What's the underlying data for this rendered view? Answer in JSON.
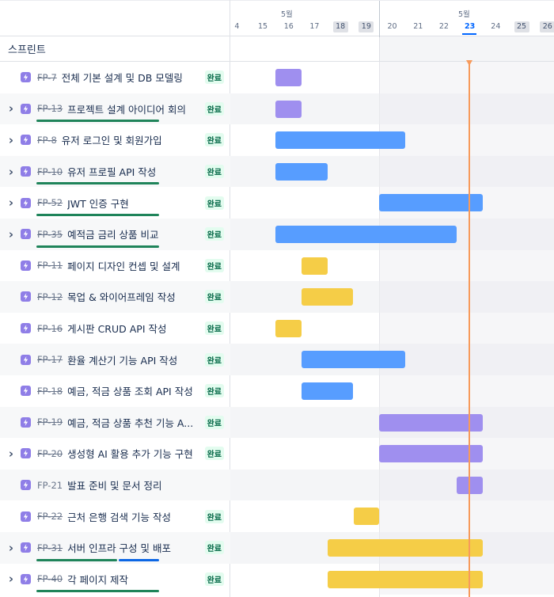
{
  "header": {
    "sprint_label": "스프린트"
  },
  "timeline": {
    "months": [
      {
        "label": "5월"
      },
      {
        "label": "5월"
      }
    ],
    "days": [
      "4",
      "15",
      "16",
      "17",
      "18",
      "19",
      "20",
      "21",
      "22",
      "23",
      "24",
      "25",
      "26"
    ],
    "weekend_days": [
      "18",
      "19",
      "25",
      "26"
    ],
    "today": "23"
  },
  "colors": {
    "purple": "#9f8fef",
    "blue": "#579dff",
    "yellow": "#f5cd47",
    "green": "#1f845a",
    "progress_blue": "#0c66e4",
    "today_line": "#f79a5b"
  },
  "status_label": "완료",
  "rows": [
    {
      "key": "FP-7",
      "title": "전체 기본 설계 및 DB 모델링",
      "expand": false,
      "done": true,
      "status": "완료",
      "progress": false,
      "bar_color": "purple",
      "start": "16",
      "end": "16"
    },
    {
      "key": "FP-13",
      "title": "프로젝트 설계 아이디어 회의",
      "expand": true,
      "done": true,
      "status": "",
      "progress": "green",
      "bar_color": "purple",
      "start": "16",
      "end": "16"
    },
    {
      "key": "FP-8",
      "title": "유저 로그인 및 회원가입",
      "expand": true,
      "done": true,
      "status": "완료",
      "progress": false,
      "bar_color": "blue",
      "start": "16",
      "end": "20"
    },
    {
      "key": "FP-10",
      "title": "유저 프로필 API 작성",
      "expand": true,
      "done": true,
      "status": "완료",
      "progress": "green",
      "bar_color": "blue",
      "start": "16",
      "end": "17"
    },
    {
      "key": "FP-52",
      "title": "JWT 인증 구현",
      "expand": true,
      "done": true,
      "status": "완료",
      "progress": "green",
      "bar_color": "blue",
      "start": "20",
      "end": "23"
    },
    {
      "key": "FP-35",
      "title": "예적금 금리 상품 비교",
      "expand": true,
      "done": true,
      "status": "완료",
      "progress": "green",
      "bar_color": "blue",
      "start": "16",
      "end": "22"
    },
    {
      "key": "FP-11",
      "title": "페이지 디자인 컨셉 및 설계",
      "expand": false,
      "done": true,
      "status": "완료",
      "progress": false,
      "bar_color": "yellow",
      "start": "17",
      "end": "17"
    },
    {
      "key": "FP-12",
      "title": "목업 & 와이어프레임 작성",
      "expand": false,
      "done": true,
      "status": "완료",
      "progress": false,
      "bar_color": "yellow",
      "start": "17",
      "end": "18"
    },
    {
      "key": "FP-16",
      "title": "게시판 CRUD API 작성",
      "expand": false,
      "done": true,
      "status": "완료",
      "progress": false,
      "bar_color": "yellow",
      "start": "16",
      "end": "16"
    },
    {
      "key": "FP-17",
      "title": "환율 계산기 기능 API 작성",
      "expand": false,
      "done": true,
      "status": "완료",
      "progress": false,
      "bar_color": "blue",
      "start": "17",
      "end": "20"
    },
    {
      "key": "FP-18",
      "title": "예금, 적금 상품 조회 API 작성",
      "expand": false,
      "done": true,
      "status": "완료",
      "progress": false,
      "bar_color": "blue",
      "start": "17",
      "end": "18"
    },
    {
      "key": "FP-19",
      "title": "예금, 적금 상품 추천 기능 A...",
      "expand": false,
      "done": true,
      "status": "완료",
      "progress": false,
      "bar_color": "purple",
      "start": "20",
      "end": "23"
    },
    {
      "key": "FP-20",
      "title": "생성형 AI 활용 추가 기능 구현",
      "expand": true,
      "done": true,
      "status": "완료",
      "progress": false,
      "bar_color": "purple",
      "start": "20",
      "end": "23"
    },
    {
      "key": "FP-21",
      "title": "발표 준비 및 문서 정리",
      "expand": false,
      "done": false,
      "status": "",
      "progress": false,
      "bar_color": "purple",
      "start": "23",
      "end": "23"
    },
    {
      "key": "FP-22",
      "title": "근처 은행 검색 기능 작성",
      "expand": false,
      "done": true,
      "status": "완료",
      "progress": false,
      "bar_color": "yellow",
      "start": "19",
      "end": "19"
    },
    {
      "key": "FP-31",
      "title": "서버 인프라 구성 및 배포",
      "expand": true,
      "done": true,
      "status": "완료",
      "progress": "green-blue",
      "bar_color": "yellow",
      "start": "18",
      "end": "23"
    },
    {
      "key": "FP-40",
      "title": "각 페이지 제작",
      "expand": true,
      "done": true,
      "status": "완료",
      "progress": "green",
      "bar_color": "yellow",
      "start": "18",
      "end": "23"
    }
  ]
}
